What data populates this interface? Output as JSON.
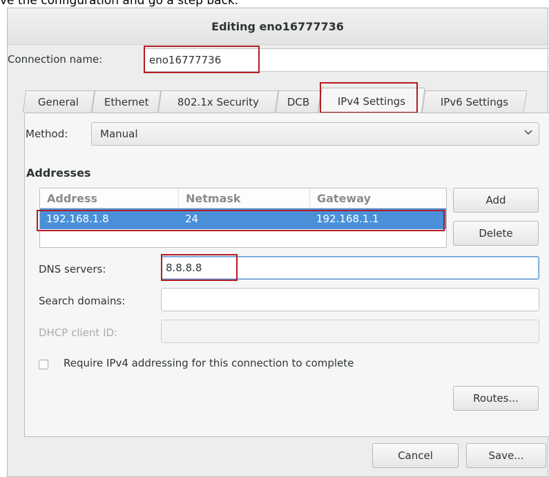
{
  "caption": "ve the configuration and go a step back.",
  "dialog": {
    "title": "Editing eno16777736",
    "connection_name_label": "Connection name:",
    "connection_name_value": "eno16777736"
  },
  "tabs": [
    {
      "label": "General"
    },
    {
      "label": "Ethernet"
    },
    {
      "label": "802.1x Security"
    },
    {
      "label": "DCB"
    },
    {
      "label": "IPv4 Settings"
    },
    {
      "label": "IPv6 Settings"
    }
  ],
  "active_tab": "IPv4 Settings",
  "ipv4": {
    "method_label": "Method:",
    "method_value": "Manual",
    "addresses_title": "Addresses",
    "columns": [
      "Address",
      "Netmask",
      "Gateway"
    ],
    "rows": [
      {
        "address": "192.168.1.8",
        "netmask": "24",
        "gateway": "192.168.1.1"
      }
    ],
    "add_label": "Add",
    "delete_label": "Delete",
    "dns_label": "DNS servers:",
    "dns_value": "8.8.8.8",
    "search_domains_label": "Search domains:",
    "search_domains_value": "",
    "dhcp_label": "DHCP client ID:",
    "dhcp_value": "",
    "require_label": "Require IPv4 addressing for this connection to complete",
    "routes_label": "Routes..."
  },
  "footer": {
    "cancel_label": "Cancel",
    "save_label": "Save..."
  },
  "colors": {
    "highlight": "#b31b22",
    "selection": "#4a90d9"
  }
}
